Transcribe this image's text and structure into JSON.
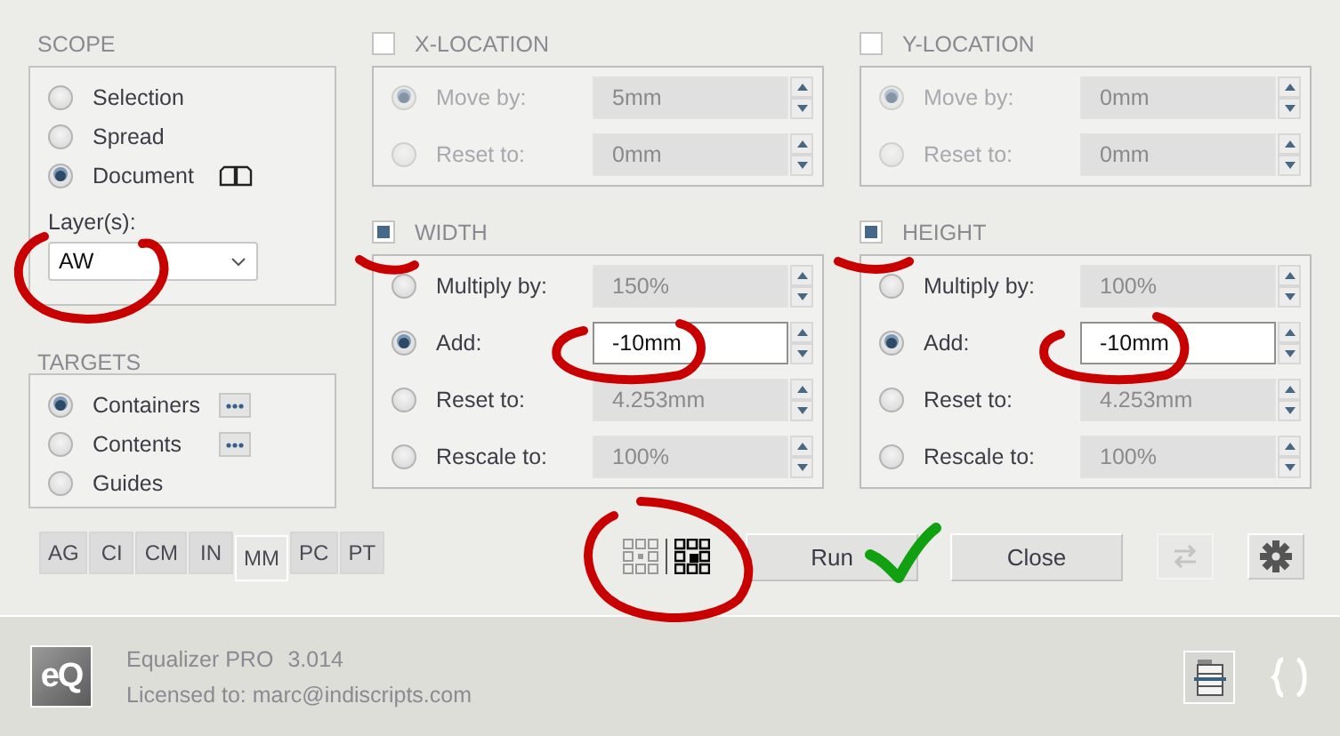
{
  "scope": {
    "title": "SCOPE",
    "options": [
      {
        "label": "Selection",
        "selected": false
      },
      {
        "label": "Spread",
        "selected": false
      },
      {
        "label": "Document",
        "selected": true
      }
    ],
    "layers": {
      "label": "Layer(s):",
      "value": "AW"
    }
  },
  "targets": {
    "title": "TARGETS",
    "options": [
      {
        "label": "Containers",
        "selected": true,
        "more_button": true
      },
      {
        "label": "Contents",
        "selected": false,
        "more_button": true
      },
      {
        "label": "Guides",
        "selected": false,
        "more_button": false
      }
    ]
  },
  "sections": [
    {
      "title": "X-LOCATION",
      "checked": false,
      "rows": [
        {
          "label": "Move by:",
          "selected": true,
          "value": "5mm",
          "active": false
        },
        {
          "label": "Reset to:",
          "selected": false,
          "value": "0mm",
          "active": false
        }
      ]
    },
    {
      "title": "Y-LOCATION",
      "checked": false,
      "rows": [
        {
          "label": "Move by:",
          "selected": true,
          "value": "0mm",
          "active": false
        },
        {
          "label": "Reset to:",
          "selected": false,
          "value": "0mm",
          "active": false
        }
      ]
    },
    {
      "title": "WIDTH",
      "checked": true,
      "rows": [
        {
          "label": "Multiply by:",
          "selected": false,
          "value": "150%",
          "active": false
        },
        {
          "label": "Add:",
          "selected": true,
          "value": "-10mm",
          "active": true
        },
        {
          "label": "Reset to:",
          "selected": false,
          "value": "4.253mm",
          "active": false
        },
        {
          "label": "Rescale to:",
          "selected": false,
          "value": "100%",
          "active": false
        }
      ]
    },
    {
      "title": "HEIGHT",
      "checked": true,
      "rows": [
        {
          "label": "Multiply by:",
          "selected": false,
          "value": "100%",
          "active": false
        },
        {
          "label": "Add:",
          "selected": true,
          "value": "-10mm",
          "active": true
        },
        {
          "label": "Reset to:",
          "selected": false,
          "value": "4.253mm",
          "active": false
        },
        {
          "label": "Rescale to:",
          "selected": false,
          "value": "100%",
          "active": false
        }
      ]
    }
  ],
  "units": [
    {
      "label": "AG",
      "selected": false
    },
    {
      "label": "CI",
      "selected": false
    },
    {
      "label": "CM",
      "selected": false
    },
    {
      "label": "IN",
      "selected": false
    },
    {
      "label": "MM",
      "selected": true
    },
    {
      "label": "PC",
      "selected": false
    },
    {
      "label": "PT",
      "selected": false
    }
  ],
  "grid_modes": [
    {
      "selected": false
    },
    {
      "selected": true
    }
  ],
  "buttons": [
    {
      "label": "Run"
    },
    {
      "label": "Close"
    }
  ],
  "swap_disabled": true,
  "footer": {
    "logo": "eQ",
    "product": "Equalizer PRO",
    "version": "3.014",
    "license": "Licensed to: marc@indiscripts.com"
  }
}
